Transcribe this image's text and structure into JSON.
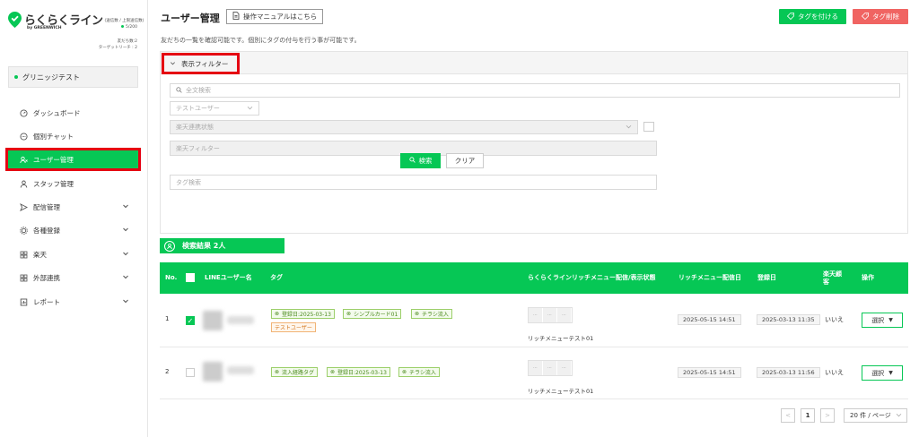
{
  "brand": {
    "name": "らくらくライン",
    "sub": "(送信数 / 上限送信数)",
    "by": "by GREENWICH",
    "send_count": "5/200",
    "friends": "友だち数:2",
    "target_reach": "ターゲットリーチ : 2"
  },
  "account": {
    "name": "グリニッジテスト"
  },
  "sidebar": {
    "items": [
      {
        "label": "ダッシュボード",
        "icon": "dashboard-icon",
        "has_chevron": false
      },
      {
        "label": "個別チャット",
        "icon": "chat-icon",
        "has_chevron": false
      },
      {
        "label": "ユーザー管理",
        "icon": "users-icon",
        "has_chevron": false,
        "active": true
      },
      {
        "label": "スタッフ管理",
        "icon": "person-icon",
        "has_chevron": false
      },
      {
        "label": "配信管理",
        "icon": "send-icon",
        "has_chevron": true
      },
      {
        "label": "各種登録",
        "icon": "gear-icon",
        "has_chevron": true
      },
      {
        "label": "楽天",
        "icon": "store-icon",
        "has_chevron": true
      },
      {
        "label": "外部連携",
        "icon": "link-icon",
        "has_chevron": true
      },
      {
        "label": "レポート",
        "icon": "report-icon",
        "has_chevron": true
      }
    ]
  },
  "header": {
    "title": "ユーザー管理",
    "manual_label": "操作マニュアルはこちら",
    "tag_add_label": "タグを付ける",
    "tag_remove_label": "タグ削除",
    "description": "友だちの一覧を確認可能です。個別にタグの付与を行う事が可能です。"
  },
  "filter": {
    "toggle_label": "表示フィルター",
    "fulltext_placeholder": "全文検索",
    "test_user_placeholder": "テストユーザー",
    "rakuten_link_placeholder": "楽天連携状態",
    "rakuten_filter_placeholder": "楽天フィルター",
    "tag_search_placeholder": "タグ検索",
    "search_label": "検索",
    "clear_label": "クリア"
  },
  "results": {
    "label": "検索結果 2人"
  },
  "table": {
    "headers": {
      "no": "No.",
      "line_name": "LINEユーザー名",
      "tags": "タグ",
      "rich_menu": "らくらくラインリッチメニュー配信/表示状態",
      "rich_menu_date": "リッチメニュー配信日",
      "registered": "登録日",
      "rakuten": "楽天顧客",
      "action": "操作"
    },
    "rows": [
      {
        "no": "1",
        "checked": true,
        "tags": [
          {
            "label": "登録日:2025-03-13",
            "color": "green"
          },
          {
            "label": "シンプルカード01",
            "color": "green"
          },
          {
            "label": "チラシ流入",
            "color": "green"
          },
          {
            "label": "テストユーザー",
            "color": "orange"
          }
        ],
        "menu_name": "リッチメニューテスト01",
        "menu_date": "2025-05-15 14:51",
        "registered": "2025-03-13 11:35",
        "rakuten": "いいえ",
        "action": "選択"
      },
      {
        "no": "2",
        "checked": false,
        "tags": [
          {
            "label": "流入経路タグ",
            "color": "green"
          },
          {
            "label": "登録日:2025-03-13",
            "color": "green"
          },
          {
            "label": "チラシ流入",
            "color": "green"
          }
        ],
        "menu_name": "リッチメニューテスト01",
        "menu_date": "2025-05-15 14:51",
        "registered": "2025-03-13 11:56",
        "rakuten": "いいえ",
        "action": "選択"
      }
    ]
  },
  "pagination": {
    "prev": "<",
    "current": "1",
    "next": ">",
    "page_size": "20 件 / ページ"
  },
  "colors": {
    "brand_green": "#06c755",
    "danger": "#f06462",
    "highlight": "#e50012"
  }
}
